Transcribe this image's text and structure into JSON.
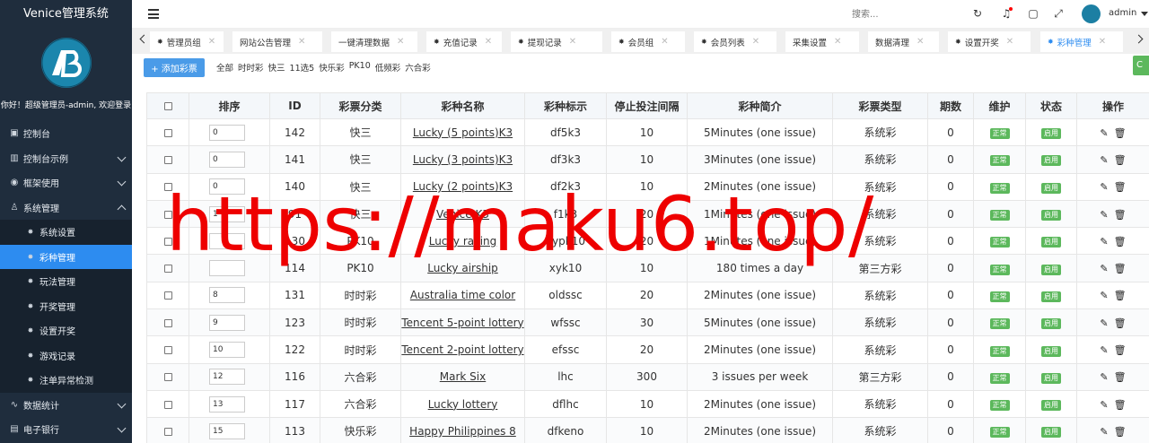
{
  "brand": "Venice管理系统",
  "welcome": "你好！超级管理员-admin, 欢迎登录",
  "menu_top": [
    {
      "label": "控制台",
      "icon": "▣",
      "icon_name": "dashboard-icon",
      "chevron": false
    },
    {
      "label": "控制台示例",
      "icon": "▥",
      "icon_name": "console-example-icon",
      "chevron": true
    },
    {
      "label": "框架使用",
      "icon": "◉",
      "icon_name": "framework-icon",
      "chevron": true
    },
    {
      "label": "系统管理",
      "icon": "♙",
      "icon_name": "user-icon",
      "chevron": true,
      "open": true
    }
  ],
  "submenu": [
    {
      "label": "系统设置",
      "active": false
    },
    {
      "label": "彩种管理",
      "active": true
    },
    {
      "label": "玩法管理",
      "active": false
    },
    {
      "label": "开奖管理",
      "active": false
    },
    {
      "label": "设置开奖",
      "active": false
    },
    {
      "label": "游戏记录",
      "active": false
    },
    {
      "label": "注单异常检测",
      "active": false
    }
  ],
  "menu_bottom": [
    {
      "label": "数据统计",
      "icon": "∿",
      "icon_name": "statistics-icon",
      "chevron": true
    },
    {
      "label": "电子银行",
      "icon": "▤",
      "icon_name": "bank-icon",
      "chevron": true
    }
  ],
  "header": {
    "search_placeholder": "搜索...",
    "user": "admin"
  },
  "tabs": [
    {
      "label": "管理员组",
      "icon": true,
      "active": false
    },
    {
      "label": "网站公告管理",
      "icon": false,
      "active": false
    },
    {
      "label": "一键清理数据",
      "icon": false,
      "active": false
    },
    {
      "label": "充值记录",
      "icon": true,
      "active": false
    },
    {
      "label": "提现记录",
      "icon": true,
      "active": false
    },
    {
      "label": "会员组",
      "icon": true,
      "active": false
    },
    {
      "label": "会员列表",
      "icon": true,
      "active": false
    },
    {
      "label": "采集设置",
      "icon": false,
      "active": false
    },
    {
      "label": "数据清理",
      "icon": false,
      "active": false
    },
    {
      "label": "设置开奖",
      "icon": true,
      "active": false
    },
    {
      "label": "彩种管理",
      "icon": true,
      "active": true
    }
  ],
  "add_button": "+ 添加彩票",
  "filters": [
    "全部",
    "时时彩",
    "快三",
    "11选5",
    "快乐彩",
    "PK10",
    "低频彩",
    "六合彩"
  ],
  "table": {
    "headers": [
      "排序",
      "ID",
      "彩票分类",
      "彩种名称",
      "彩种标示",
      "停止投注间隔",
      "彩种简介",
      "彩票类型",
      "期数",
      "维护",
      "状态",
      "操作"
    ],
    "rows": [
      {
        "sort": "0",
        "id": "142",
        "category": "快三",
        "name": "Lucky (5 points)K3",
        "code": "df5k3",
        "interval": "10",
        "intro": "5Minutes (one issue)",
        "type": "系统彩",
        "periods": "0",
        "maint": "正常",
        "status": "启用"
      },
      {
        "sort": "0",
        "id": "141",
        "category": "快三",
        "name": "Lucky (3 points)K3",
        "code": "df3k3",
        "interval": "10",
        "intro": "3Minutes (one issue)",
        "type": "系统彩",
        "periods": "0",
        "maint": "正常",
        "status": "启用"
      },
      {
        "sort": "0",
        "id": "140",
        "category": "快三",
        "name": "Lucky (2 points)K3",
        "code": "df2k3",
        "interval": "10",
        "intro": "2Minutes (one issue)",
        "type": "系统彩",
        "periods": "0",
        "maint": "正常",
        "status": "启用"
      },
      {
        "sort": "1",
        "id": "91",
        "category": "快三",
        "name": "Venice K3",
        "code": "f1k3",
        "interval": "20",
        "intro": "1Minutes (one issue)",
        "type": "系统彩",
        "periods": "0",
        "maint": "正常",
        "status": "启用"
      },
      {
        "sort": "",
        "id": "130",
        "category": "PK10",
        "name": "Lucky racing",
        "code": "xypk10",
        "interval": "20",
        "intro": "1Minutes (one issue)",
        "type": "系统彩",
        "periods": "0",
        "maint": "正常",
        "status": "启用"
      },
      {
        "sort": "",
        "id": "114",
        "category": "PK10",
        "name": "Lucky airship",
        "code": "xyk10",
        "interval": "10",
        "intro": "180 times a day",
        "type": "第三方彩",
        "periods": "0",
        "maint": "正常",
        "status": "启用"
      },
      {
        "sort": "8",
        "id": "131",
        "category": "时时彩",
        "name": "Australia time color",
        "code": "oldssc",
        "interval": "20",
        "intro": "2Minutes (one issue)",
        "type": "系统彩",
        "periods": "0",
        "maint": "正常",
        "status": "启用"
      },
      {
        "sort": "9",
        "id": "123",
        "category": "时时彩",
        "name": "Tencent 5-point lottery",
        "code": "wfssc",
        "interval": "30",
        "intro": "5Minutes (one issue)",
        "type": "系统彩",
        "periods": "0",
        "maint": "正常",
        "status": "启用"
      },
      {
        "sort": "10",
        "id": "122",
        "category": "时时彩",
        "name": "Tencent 2-point lottery",
        "code": "efssc",
        "interval": "20",
        "intro": "2Minutes (one issue)",
        "type": "系统彩",
        "periods": "0",
        "maint": "正常",
        "status": "启用"
      },
      {
        "sort": "12",
        "id": "116",
        "category": "六合彩",
        "name": "Mark Six",
        "code": "lhc",
        "interval": "300",
        "intro": "3 issues per week",
        "type": "第三方彩",
        "periods": "0",
        "maint": "正常",
        "status": "启用"
      },
      {
        "sort": "13",
        "id": "117",
        "category": "六合彩",
        "name": "Lucky lottery",
        "code": "dflhc",
        "interval": "10",
        "intro": "2Minutes (one issue)",
        "type": "系统彩",
        "periods": "0",
        "maint": "正常",
        "status": "启用"
      },
      {
        "sort": "15",
        "id": "113",
        "category": "快乐彩",
        "name": "Happy Philippines 8",
        "code": "dfkeno",
        "interval": "10",
        "intro": "2Minutes (one issue)",
        "type": "系统彩",
        "periods": "0",
        "maint": "正常",
        "status": "启用"
      }
    ]
  },
  "watermark": "https://maku6.top/",
  "colors": {
    "sidebar": "#1f2d3d",
    "active": "#2d8cf0",
    "badge": "#5cb85c",
    "watermark": "#ee0000"
  }
}
